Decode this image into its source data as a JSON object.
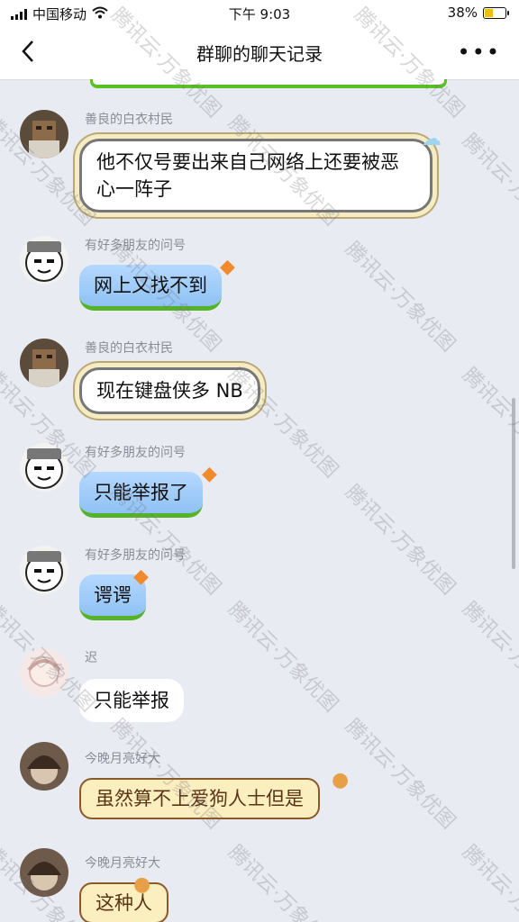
{
  "status_bar": {
    "carrier": "中国移动",
    "time": "下午 9:03",
    "battery": "38%"
  },
  "header": {
    "title": "群聊的聊天记录"
  },
  "messages": [
    {
      "sender": "善良的白衣村民",
      "text": "他不仅号要出来自己网络上还要被恶心一阵子",
      "style": "white-frame"
    },
    {
      "sender": "有好多朋友的问号",
      "text": "网上又找不到",
      "style": "sky"
    },
    {
      "sender": "善良的白衣村民",
      "text": "现在键盘侠多 NB",
      "style": "white-frame"
    },
    {
      "sender": "有好多朋友的问号",
      "text": "只能举报了",
      "style": "sky"
    },
    {
      "sender": "有好多朋友的问号",
      "text": "谔谔",
      "style": "sky"
    },
    {
      "sender": "迟",
      "text": "只能举报",
      "style": "plain"
    },
    {
      "sender": "今晚月亮好大",
      "text": "虽然算不上爱狗人士但是",
      "style": "cream"
    },
    {
      "sender": "今晚月亮好大",
      "text": "这种人",
      "style": "cream"
    }
  ],
  "watermark": "腾讯云·万象优图",
  "colors": {
    "chat_background": "#e9ebf3",
    "sky_bubble": "#a6cff9",
    "grass_green": "#56b328",
    "cream_bubble": "#fbeebf"
  }
}
